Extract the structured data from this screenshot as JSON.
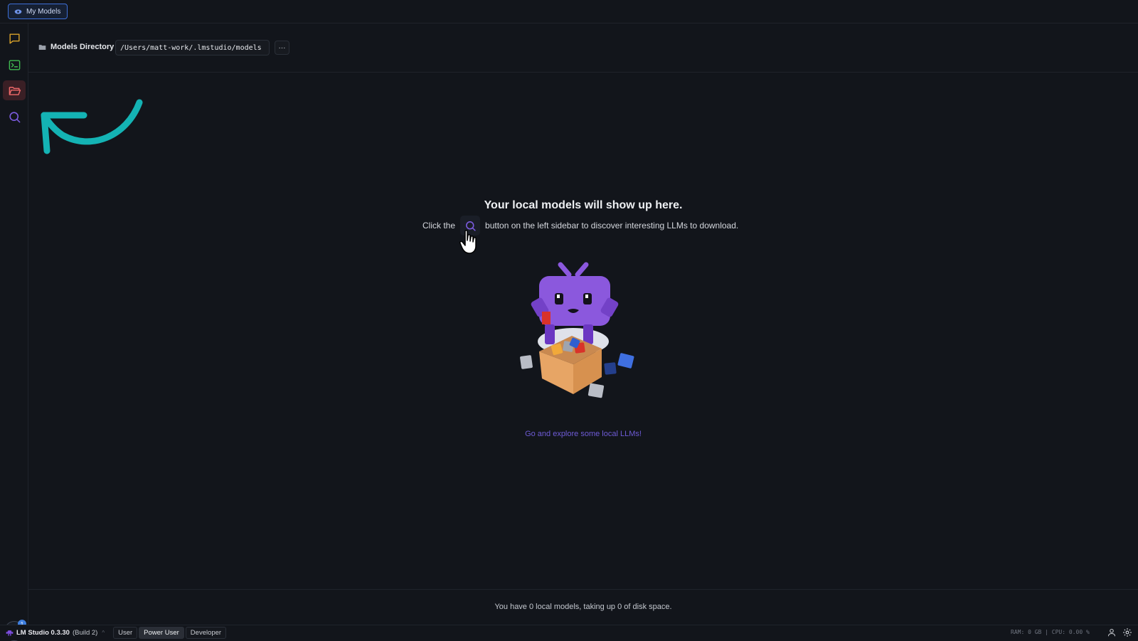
{
  "topbar": {
    "tab_label": "My Models"
  },
  "sidebar": {
    "items": [
      {
        "name": "chat",
        "icon": "chat-bubble-icon",
        "active": false
      },
      {
        "name": "developer",
        "icon": "terminal-icon",
        "active": false
      },
      {
        "name": "my-models",
        "icon": "folder-open-icon",
        "active": true
      },
      {
        "name": "discover",
        "icon": "search-icon",
        "active": false
      }
    ],
    "download_badge": "1"
  },
  "directory": {
    "label": "Models Directory",
    "path": "/Users/matt-work/.lmstudio/models",
    "more_label": "···"
  },
  "empty_state": {
    "title": "Your local models will show up here.",
    "desc_before": "Click the",
    "desc_after": "button on the left sidebar to discover interesting LLMs to download.",
    "link": "Go and explore some local LLMs!"
  },
  "footer": {
    "disk_info": "You have 0 local models, taking up 0 of disk space."
  },
  "statusbar": {
    "app_name": "LM Studio 0.3.30",
    "build": "(Build 2)",
    "modes": [
      "User",
      "Power User",
      "Developer"
    ],
    "selected_mode": "Power User",
    "stats": "RAM: 0 GB  |  CPU: 0.00 %"
  },
  "colors": {
    "accent": "#3d6fd8",
    "brand": "#7c4dde",
    "annotation": "#14b3b4",
    "link": "#6e5bd6"
  }
}
